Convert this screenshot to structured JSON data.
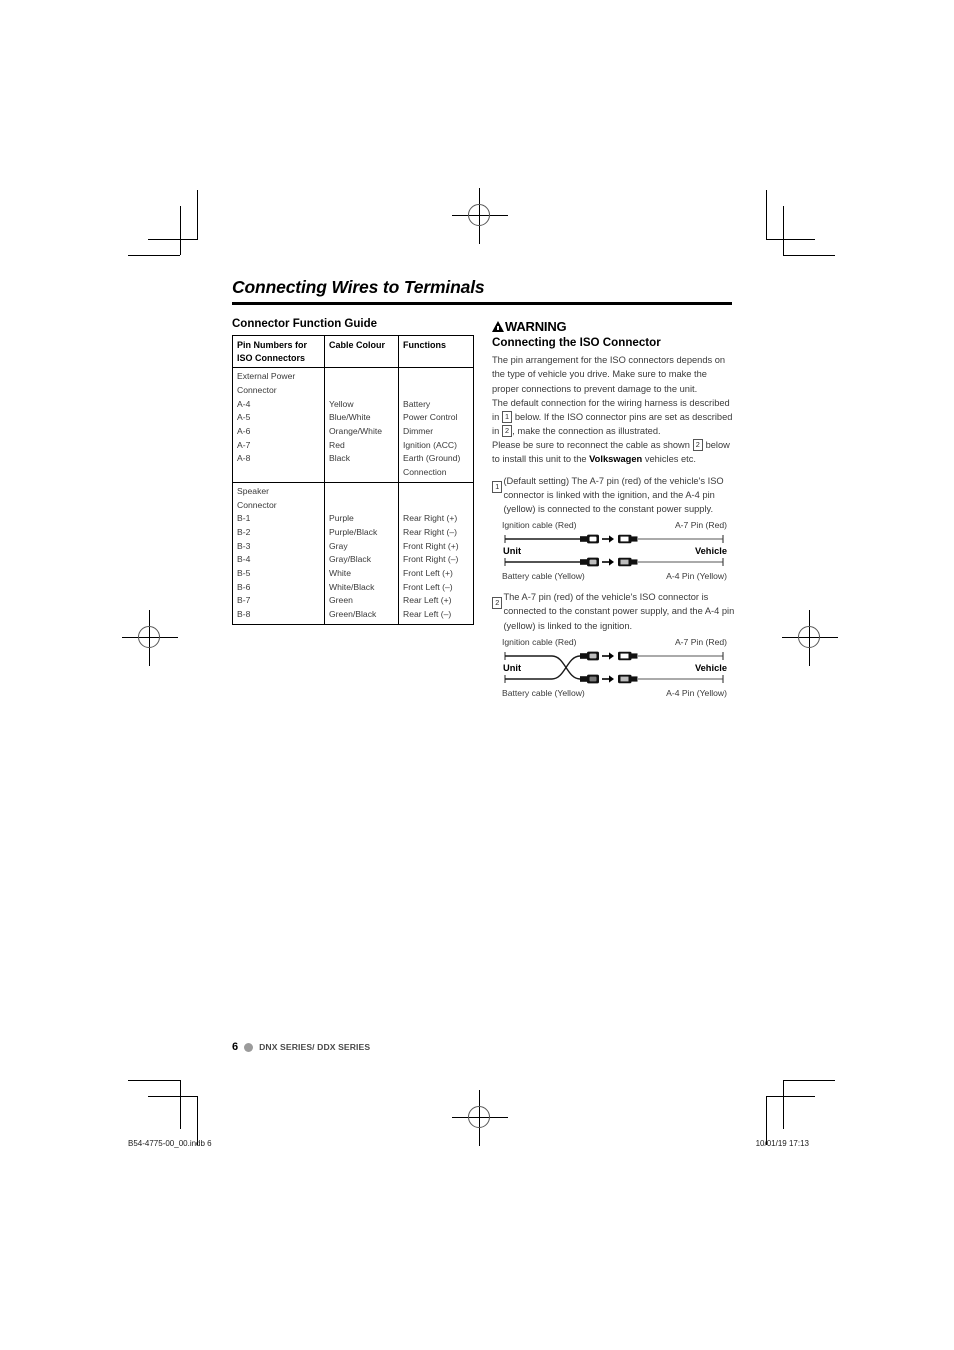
{
  "document": {
    "title": "Connecting Wires to Terminals"
  },
  "left_column": {
    "section_title": "Connector Function Guide",
    "table": {
      "headers": [
        "Pin Numbers for ISO Connectors",
        "Cable Colour",
        "Functions"
      ],
      "groups": [
        {
          "pins": "External Power\nConnector\nA-4\nA-5\nA-6\nA-7\nA-8",
          "colours": "\n\nYellow\nBlue/White\nOrange/White\nRed\nBlack",
          "functions": "\n\nBattery\nPower Control\nDimmer\nIgnition (ACC)\nEarth (Ground)\nConnection"
        },
        {
          "pins": "Speaker\nConnector\nB-1\nB-2\nB-3\nB-4\nB-5\nB-6\nB-7\nB-8",
          "colours": "\n\nPurple\nPurple/Black\nGray\nGray/Black\nWhite\nWhite/Black\nGreen\nGreen/Black",
          "functions": "\n\nRear Right (+)\nRear Right (–)\nFront Right (+)\nFront Right (–)\nFront Left (+)\nFront Left (–)\nRear Left (+)\nRear Left (–)"
        }
      ]
    }
  },
  "right_column": {
    "warning_label": "WARNING",
    "section_title": "Connecting the ISO Connector",
    "intro_paragraph_1": "The pin arrangement for the ISO connectors depends on the type of vehicle you drive. Make sure to make the proper connections to prevent damage to the unit.",
    "intro_paragraph_2_a": "The default connection for the wiring harness is described in",
    "intro_paragraph_2_num1": "1",
    "intro_paragraph_2_b": "below. If the ISO connector pins are set as described in",
    "intro_paragraph_2_num2": "2",
    "intro_paragraph_2_c": ", make the connection as illustrated.",
    "intro_paragraph_3_a": "Please be sure to reconnect the cable as shown",
    "intro_paragraph_3_num": "2",
    "intro_paragraph_3_b": "below to install this unit to the",
    "intro_paragraph_3_bold": "Volkswagen",
    "intro_paragraph_3_c": "vehicles etc.",
    "steps": [
      {
        "number": "1",
        "text": "(Default setting) The A-7 pin (red) of the vehicle's ISO connector is linked with the ignition, and the A-4 pin (yellow) is connected to the constant power supply.",
        "diagram": {
          "crossed": false,
          "top_left_label": "Ignition cable (Red)",
          "top_right_label": "A-7 Pin (Red)",
          "bottom_left_label": "Battery cable (Yellow)",
          "bottom_right_label": "A-4 Pin (Yellow)",
          "unit_label": "Unit",
          "vehicle_label": "Vehicle"
        }
      },
      {
        "number": "2",
        "text": "The A-7 pin (red) of the vehicle's ISO connector is connected to the constant power supply, and the A-4 pin (yellow) is linked to the ignition.",
        "diagram": {
          "crossed": true,
          "top_left_label": "Ignition cable (Red)",
          "top_right_label": "A-7 Pin (Red)",
          "bottom_left_label": "Battery cable (Yellow)",
          "bottom_right_label": "A-4 Pin (Yellow)",
          "unit_label": "Unit",
          "vehicle_label": "Vehicle"
        }
      }
    ]
  },
  "footer": {
    "page_number": "6",
    "series_text": "DNX SERIES/ DDX SERIES",
    "print_file": "B54-4775-00_00.indb   6",
    "print_timestamp": "10/01/19   17:13"
  },
  "colors": {
    "rule": "#000000",
    "body_text": "#3a3a3a",
    "footer_dot": "#9b9b9b"
  }
}
